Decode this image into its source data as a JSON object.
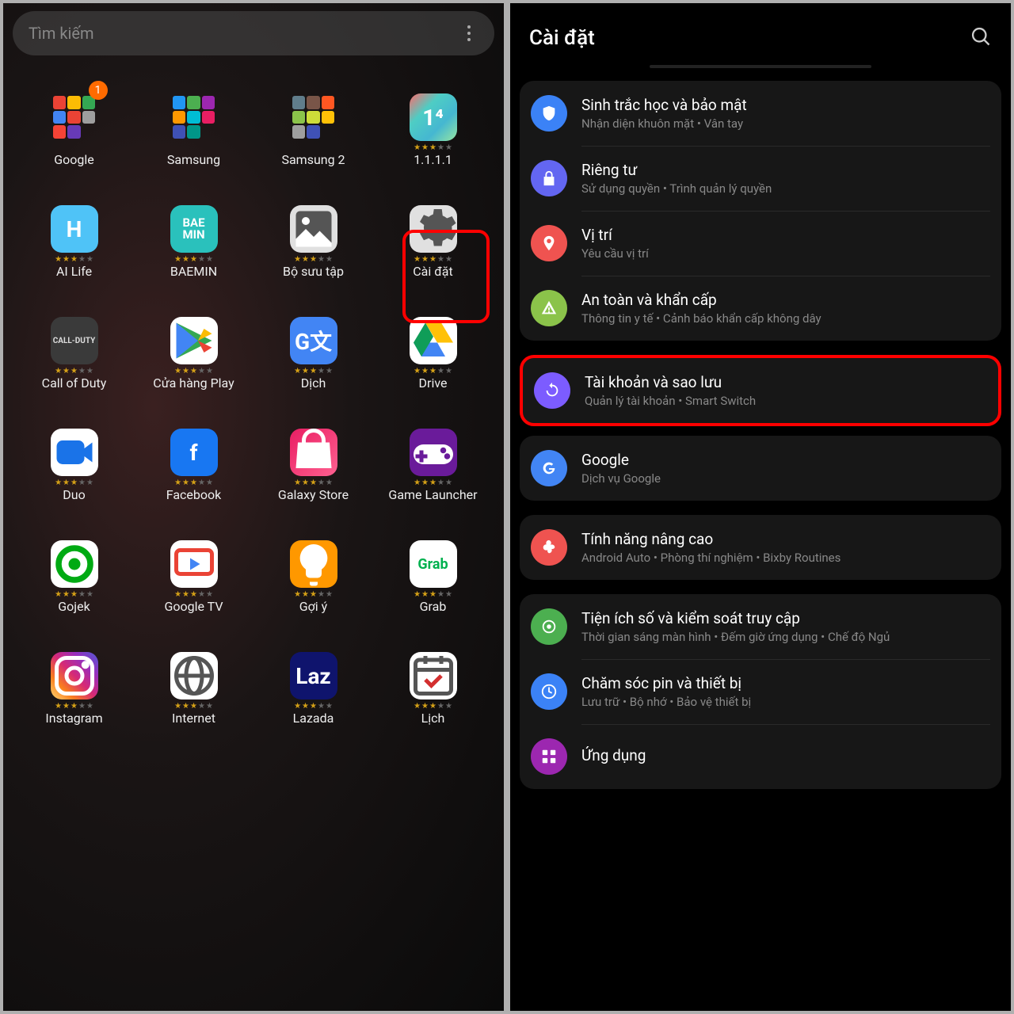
{
  "left": {
    "search_placeholder": "Tìm kiếm",
    "apps": [
      {
        "label": "Google",
        "type": "folder",
        "badge": "1"
      },
      {
        "label": "Samsung",
        "type": "folder"
      },
      {
        "label": "Samsung 2",
        "type": "folder"
      },
      {
        "label": "1.1.1.1",
        "icon": "1111",
        "text": "1⁴"
      },
      {
        "label": "AI Life",
        "icon": "ailife",
        "text": "H"
      },
      {
        "label": "BAEMIN",
        "icon": "baemin",
        "text": "BAE\nMIN"
      },
      {
        "label": "Bộ sưu tập",
        "icon": "gallery",
        "svg": "gallery"
      },
      {
        "label": "Cài đặt",
        "icon": "settings",
        "svg": "gear",
        "highlighted": true
      },
      {
        "label": "Call of Duty",
        "icon": "cod",
        "text": "CALL-DUTY"
      },
      {
        "label": "Cửa hàng Play",
        "icon": "play",
        "svg": "play"
      },
      {
        "label": "Dịch",
        "icon": "dich",
        "text": "G文"
      },
      {
        "label": "Drive",
        "icon": "drive",
        "svg": "drive"
      },
      {
        "label": "Duo",
        "icon": "duo",
        "svg": "duo"
      },
      {
        "label": "Facebook",
        "icon": "fb",
        "text": "f"
      },
      {
        "label": "Galaxy Store",
        "icon": "galaxystore",
        "svg": "bag"
      },
      {
        "label": "Game Launcher",
        "icon": "gamelauncher",
        "svg": "pad"
      },
      {
        "label": "Gojek",
        "icon": "gojek",
        "svg": "gojek"
      },
      {
        "label": "Google TV",
        "icon": "gtv",
        "svg": "gtv"
      },
      {
        "label": "Gợi ý",
        "icon": "goiy",
        "svg": "bulb"
      },
      {
        "label": "Grab",
        "icon": "grab",
        "text": "Grab"
      },
      {
        "label": "Instagram",
        "icon": "insta",
        "svg": "insta"
      },
      {
        "label": "Internet",
        "icon": "internet",
        "svg": "globe"
      },
      {
        "label": "Lazada",
        "icon": "lazada",
        "text": "Laz"
      },
      {
        "label": "Lịch",
        "icon": "lich",
        "svg": "cal"
      }
    ]
  },
  "right": {
    "title": "Cài đặt",
    "groups": [
      {
        "items": [
          {
            "title": "Sinh trắc học và bảo mật",
            "sub": "Nhận diện khuôn mặt  •  Vân tay",
            "color": "#3b82f6",
            "svg": "shield"
          },
          {
            "title": "Riêng tư",
            "sub": "Sử dụng quyền  •  Trình quản lý quyền",
            "color": "#6366f1",
            "svg": "lock"
          },
          {
            "title": "Vị trí",
            "sub": "Yêu cầu vị trí",
            "color": "#ef5350",
            "svg": "pin"
          },
          {
            "title": "An toàn và khẩn cấp",
            "sub": "Thông tin y tế  •  Cảnh báo khẩn cấp không dây",
            "color": "#8bc34a",
            "svg": "alert"
          }
        ]
      },
      {
        "highlighted": true,
        "items": [
          {
            "title": "Tài khoản và sao lưu",
            "sub": "Quản lý tài khoản  •  Smart Switch",
            "color": "#7c5cff",
            "svg": "sync"
          }
        ]
      },
      {
        "items": [
          {
            "title": "Google",
            "sub": "Dịch vụ Google",
            "color": "#4285f4",
            "svg": "google"
          }
        ]
      },
      {
        "items": [
          {
            "title": "Tính năng nâng cao",
            "sub": "Android Auto  •  Phòng thí nghiệm  •  Bixby Routines",
            "color": "#ef5350",
            "svg": "plus"
          }
        ]
      },
      {
        "items": [
          {
            "title": "Tiện ích số và kiểm soát truy cập",
            "sub": "Thời gian sáng màn hình  •  Đếm giờ ứng dụng  •  Chế độ Ngủ",
            "color": "#4caf50",
            "svg": "digital"
          },
          {
            "title": "Chăm sóc pin và thiết bị",
            "sub": "Lưu trữ  •  Bộ nhớ  •  Bảo vệ thiết bị",
            "color": "#3b82f6",
            "svg": "care"
          },
          {
            "title": "Ứng dụng",
            "sub": "",
            "color": "#9c27b0",
            "svg": "apps"
          }
        ]
      }
    ]
  }
}
